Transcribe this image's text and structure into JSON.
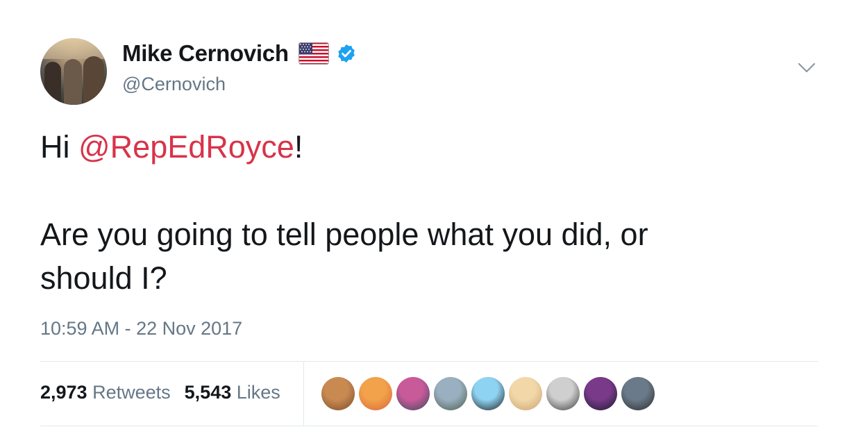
{
  "tweet": {
    "author": {
      "display_name": "Mike Cernovich",
      "handle": "@Cernovich",
      "flag_icon": "us-flag-icon",
      "verified_icon": "verified-badge-icon"
    },
    "text": {
      "greeting": "Hi ",
      "mention": "@RepEdRoyce",
      "greeting_end": "!",
      "line2": "Are you going to tell people what you did, or",
      "line3": "should I?"
    },
    "timestamp": "10:59 AM - 22 Nov 2017",
    "stats": {
      "retweets_count": "2,973",
      "retweets_label": "Retweets",
      "likes_count": "5,543",
      "likes_label": "Likes"
    },
    "liker_avatars": [
      {
        "name": "liker-avatar-dog",
        "colors": [
          "#c98a52",
          "#7a4a2a"
        ]
      },
      {
        "name": "liker-avatar-sunset",
        "colors": [
          "#f2a24a",
          "#d8653a"
        ]
      },
      {
        "name": "liker-avatar-group",
        "colors": [
          "#c95a9a",
          "#3a4a5a"
        ]
      },
      {
        "name": "liker-avatar-landscape",
        "colors": [
          "#9ab0c0",
          "#4a5a4a"
        ]
      },
      {
        "name": "liker-avatar-eye",
        "colors": [
          "#8fd3f2",
          "#1a1a1a"
        ]
      },
      {
        "name": "liker-avatar-blonde",
        "colors": [
          "#f2d8a8",
          "#c9a070"
        ]
      },
      {
        "name": "liker-avatar-bw-portrait",
        "colors": [
          "#cfcfcf",
          "#3a3a3a"
        ]
      },
      {
        "name": "liker-avatar-lips",
        "colors": [
          "#7a3a8a",
          "#1a1a2a"
        ]
      },
      {
        "name": "liker-avatar-dark",
        "colors": [
          "#6a7a8a",
          "#2a2a2a"
        ]
      }
    ],
    "caret_icon": "chevron-down-icon",
    "colors": {
      "mention": "#d8334a",
      "secondary_text": "#657786",
      "verified": "#1da1f2"
    }
  }
}
